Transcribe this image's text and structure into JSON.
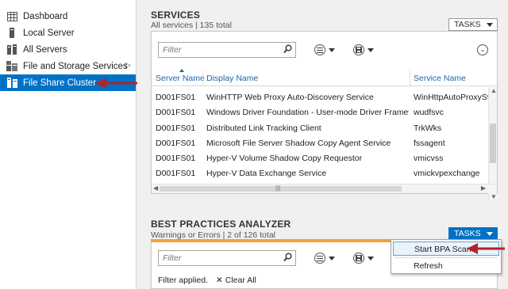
{
  "sidebar": {
    "items": [
      {
        "label": "Dashboard",
        "icon": "dashboard-icon"
      },
      {
        "label": "Local Server",
        "icon": "server-icon"
      },
      {
        "label": "All Servers",
        "icon": "servers-icon"
      },
      {
        "label": "File and Storage Services",
        "icon": "file-storage-icon",
        "has_chevron": true
      },
      {
        "label": "File Share Cluster",
        "icon": "cluster-icon",
        "active": true
      }
    ]
  },
  "services": {
    "title": "SERVICES",
    "subtitle": "All services | 135 total",
    "tasks_label": "TASKS",
    "filter_placeholder": "Filter",
    "columns": [
      "Server Name",
      "Display Name",
      "Service Name"
    ],
    "rows": [
      [
        "D001FS01",
        "WinHTTP Web Proxy Auto-Discovery Service",
        "WinHttpAutoProxySvc"
      ],
      [
        "D001FS01",
        "Windows Driver Foundation - User-mode Driver Framework",
        "wudfsvc"
      ],
      [
        "D001FS01",
        "Distributed Link Tracking Client",
        "TrkWks"
      ],
      [
        "D001FS01",
        "Microsoft File Server Shadow Copy Agent Service",
        "fssagent"
      ],
      [
        "D001FS01",
        "Hyper-V Volume Shadow Copy Requestor",
        "vmicvss"
      ],
      [
        "D001FS01",
        "Hyper-V Data Exchange Service",
        "vmickvpexchange"
      ]
    ]
  },
  "bpa": {
    "title": "BEST PRACTICES ANALYZER",
    "subtitle": "Warnings or Errors | 2 of 126 total",
    "tasks_label": "TASKS",
    "filter_placeholder": "Filter",
    "filter_status": "Filter applied.",
    "clear_all": "Clear All"
  },
  "tasks_menu": {
    "items": [
      "Start BPA Scan",
      "Refresh"
    ]
  },
  "colors": {
    "accent": "#0072c6",
    "arrow": "#b3232a",
    "warning_bar": "#f3a03a"
  }
}
